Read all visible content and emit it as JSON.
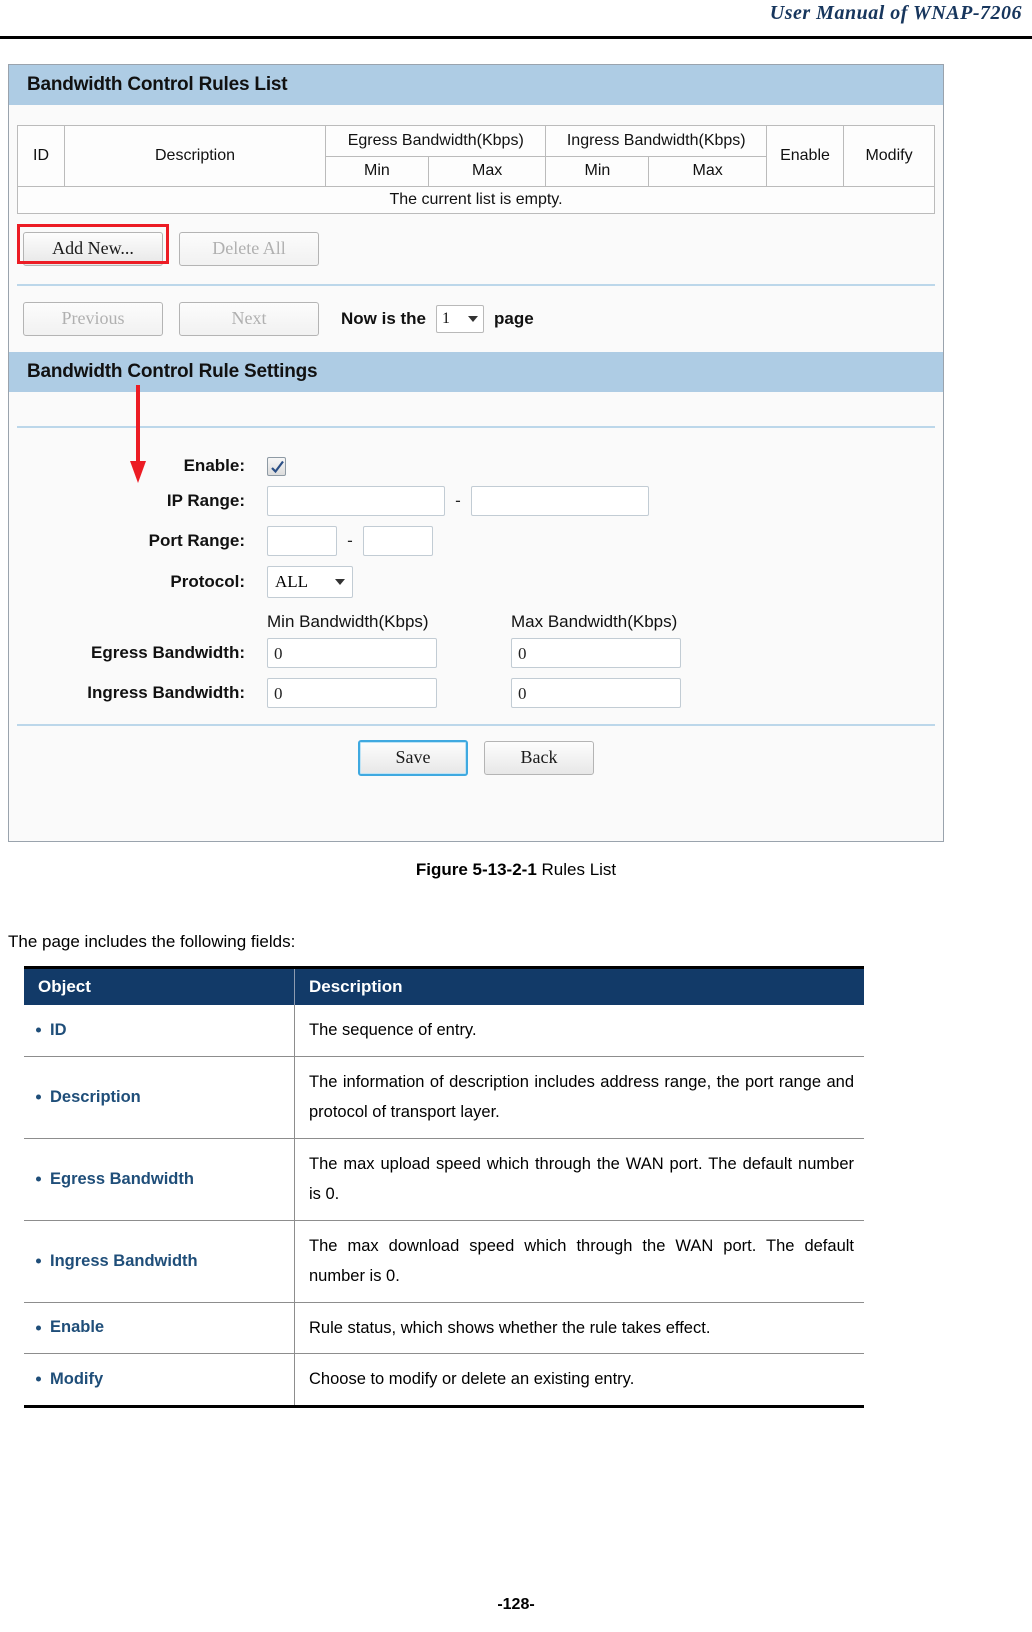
{
  "header": {
    "manual_title": "User Manual of WNAP-7206"
  },
  "screenshot": {
    "list_panel": {
      "title": "Bandwidth Control Rules List",
      "table": {
        "columns": {
          "id": "ID",
          "description": "Description",
          "egress": "Egress Bandwidth(Kbps)",
          "ingress": "Ingress Bandwidth(Kbps)",
          "enable": "Enable",
          "modify": "Modify",
          "egress_min": "Min",
          "egress_max": "Max",
          "ingress_min": "Min",
          "ingress_max": "Max"
        },
        "empty_message": "The current list is empty.",
        "rows": []
      },
      "buttons": {
        "add_new": "Add New...",
        "delete_all": "Delete All",
        "previous": "Previous",
        "next": "Next"
      },
      "pager": {
        "prefix": "Now is the",
        "current_page": "1",
        "suffix": "page",
        "options": [
          "1"
        ]
      }
    },
    "settings_panel": {
      "title": "Bandwidth Control Rule Settings",
      "fields": {
        "enable_label": "Enable:",
        "enable_checked": true,
        "ip_range_label": "IP Range:",
        "ip_range_start": "",
        "ip_range_end": "",
        "ip_range_separator": "-",
        "port_range_label": "Port Range:",
        "port_range_start": "",
        "port_range_end": "",
        "port_range_separator": "-",
        "protocol_label": "Protocol:",
        "protocol_value": "ALL",
        "protocol_options": [
          "ALL"
        ],
        "min_bandwidth_header": "Min Bandwidth(Kbps)",
        "max_bandwidth_header": "Max Bandwidth(Kbps)",
        "egress_label": "Egress Bandwidth:",
        "egress_min": "0",
        "egress_max": "0",
        "ingress_label": "Ingress Bandwidth:",
        "ingress_min": "0",
        "ingress_max": "0"
      },
      "buttons": {
        "save": "Save",
        "back": "Back"
      }
    },
    "annotation": {
      "highlight_color": "#ec1c24",
      "highlight_target": "Add New...",
      "arrow_color": "#ec1c24"
    }
  },
  "figure": {
    "number": "Figure 5-13-2-1",
    "caption": "Rules List"
  },
  "body": {
    "intro": "The page includes the following fields:"
  },
  "desc_table": {
    "headers": {
      "object": "Object",
      "description": "Description"
    },
    "rows": [
      {
        "object": "ID",
        "description": "The sequence of entry."
      },
      {
        "object": "Description",
        "description": "The information of description includes address range, the port range and protocol of transport layer."
      },
      {
        "object": "Egress Bandwidth",
        "description": "The max upload speed which through the WAN port. The default number is 0."
      },
      {
        "object": "Ingress Bandwidth",
        "description": "The max download speed which through the WAN port. The default number is 0."
      },
      {
        "object": "Enable",
        "description": "Rule status, which shows whether the rule takes effect."
      },
      {
        "object": "Modify",
        "description": "Choose to modify or delete an existing entry."
      }
    ]
  },
  "footer": {
    "page_number": "-128-"
  }
}
